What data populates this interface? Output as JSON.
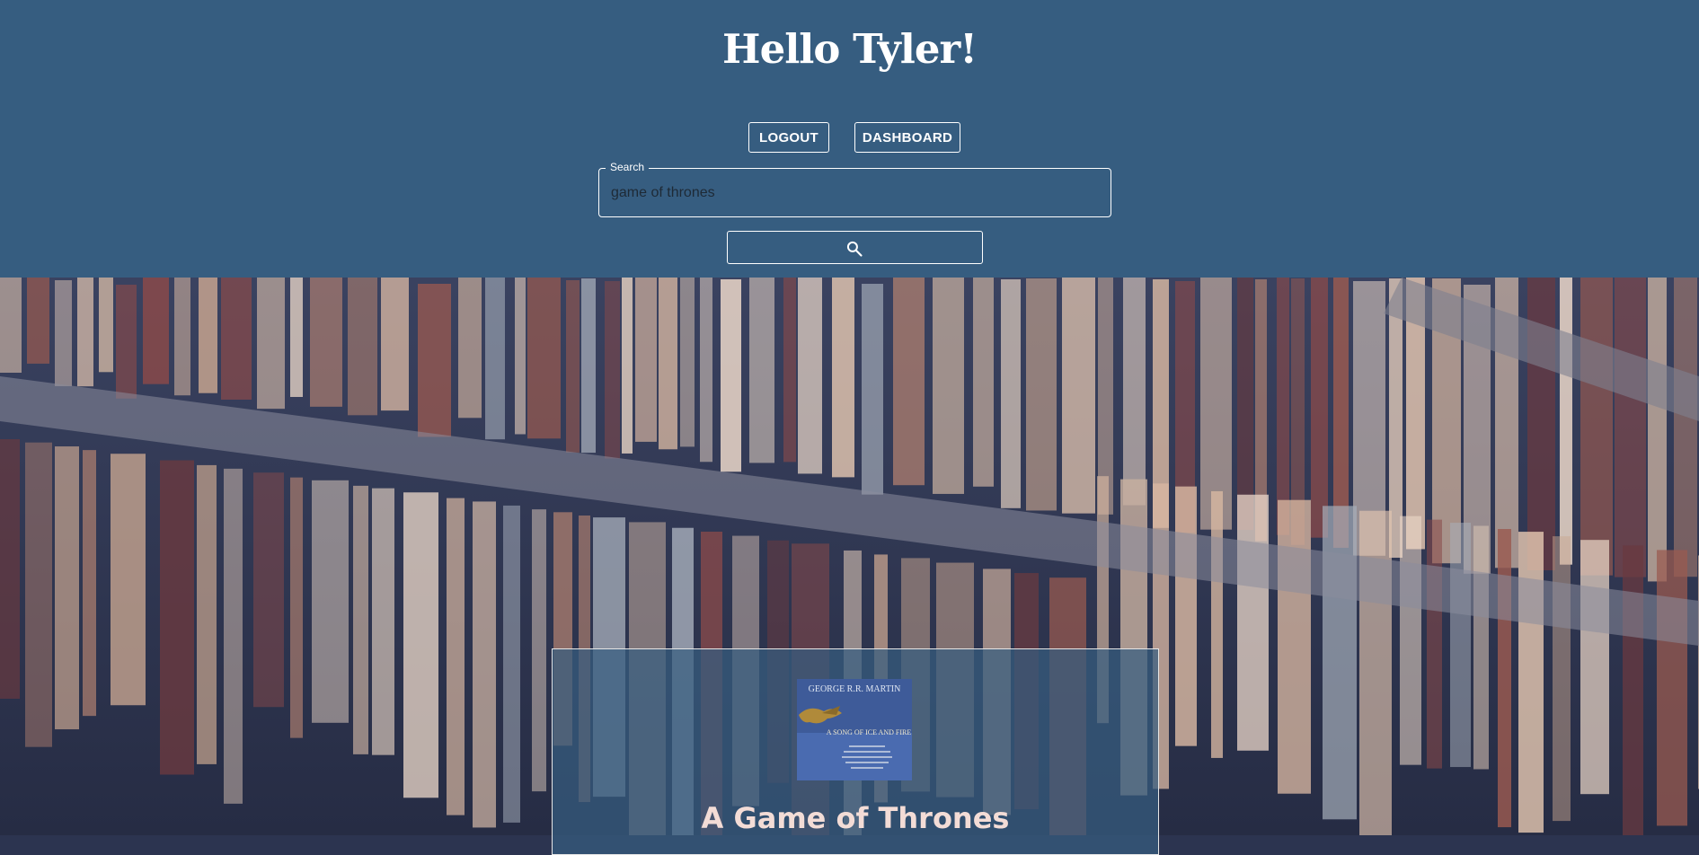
{
  "header": {
    "greeting": "Hello Tyler!",
    "logout_label": "LOGOUT",
    "dashboard_label": "DASHBOARD"
  },
  "search": {
    "label": "Search",
    "value": "game of thrones",
    "button_icon": "search-icon"
  },
  "results": [
    {
      "title": "A Game of Thrones",
      "cover": {
        "author": "GEORGE R.R. MARTIN",
        "series": "A SONG OF ICE AND FIRE"
      }
    }
  ],
  "colors": {
    "header_bg": "#365d80",
    "title_text": "#f3dcd6"
  }
}
